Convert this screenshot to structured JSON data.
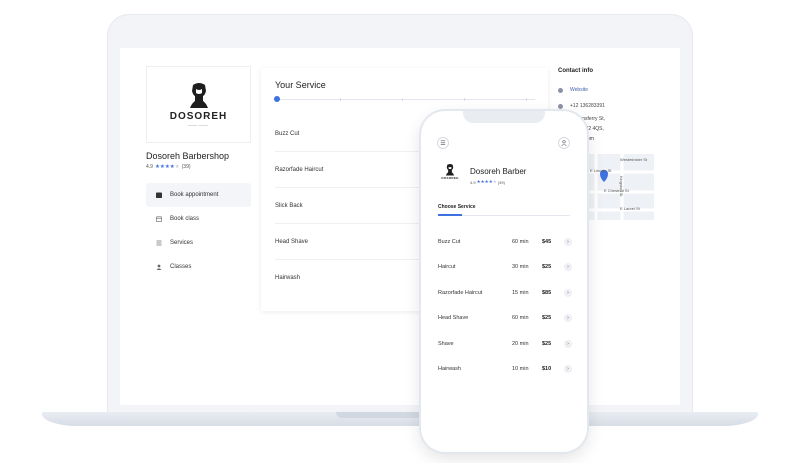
{
  "shop": {
    "logo_word": "DOSOREH",
    "name": "Dosoreh Barbershop",
    "rating": "4.9",
    "reviews": "(39)",
    "stars": [
      1,
      1,
      1,
      1,
      0
    ]
  },
  "nav": [
    {
      "label": "Book appointment",
      "icon": "calendar-check-icon",
      "active": true
    },
    {
      "label": "Book class",
      "icon": "calendar-icon",
      "active": false
    },
    {
      "label": "Services",
      "icon": "list-icon",
      "active": false
    },
    {
      "label": "Classes",
      "icon": "group-icon",
      "active": false
    }
  ],
  "services_card": {
    "title": "Your Service",
    "items": [
      "Buzz Cut",
      "Razorfade Haircut",
      "Slick Back",
      "Head Shave",
      "Hairwash"
    ]
  },
  "contact": {
    "title": "Contact info",
    "website": "Website",
    "phone": "+12 136283391",
    "address_line1": "Queensferry St,",
    "address_line2": "urgh EH2 4QS,",
    "address_line3": "d Kingdom"
  },
  "map": {
    "labels": [
      "Westminster St",
      "E Lincoln St",
      "E Chestnut St",
      "E Laurel St",
      "Kingston St"
    ]
  },
  "phone": {
    "shop_name": "Dosoreh Barber",
    "rating": "4.9",
    "reviews": "(39)",
    "choose_label": "Choose Service",
    "services": [
      {
        "name": "Buzz Cut",
        "duration": "60 min",
        "price": "$45"
      },
      {
        "name": "Haircut",
        "duration": "30 min",
        "price": "$25"
      },
      {
        "name": "Razorfade Haircut",
        "duration": "15 min",
        "price": "$85"
      },
      {
        "name": "Head Shave",
        "duration": "60 min",
        "price": "$25"
      },
      {
        "name": "Shave",
        "duration": "20 min",
        "price": "$25"
      },
      {
        "name": "Hairwash",
        "duration": "10 min",
        "price": "$10"
      }
    ]
  },
  "colors": {
    "accent": "#3f72e0"
  }
}
